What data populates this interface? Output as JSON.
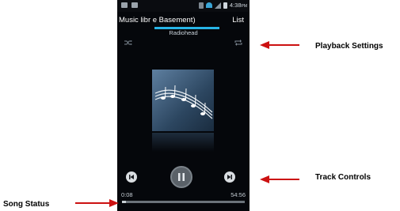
{
  "status_bar": {
    "time": "4:38",
    "ampm": "PM"
  },
  "header": {
    "title": "Music libr e Basement)",
    "list_label": "List"
  },
  "now_playing": {
    "artist": "Radiohead"
  },
  "playback": {
    "elapsed": "0:08",
    "total": "54:56",
    "progress_fraction": 0.03
  },
  "annotations": {
    "playback_settings": "Playback Settings",
    "track_controls": "Track Controls",
    "song_status": "Song Status"
  },
  "colors": {
    "accent": "#27b4e6",
    "arrow": "#cc1111"
  }
}
